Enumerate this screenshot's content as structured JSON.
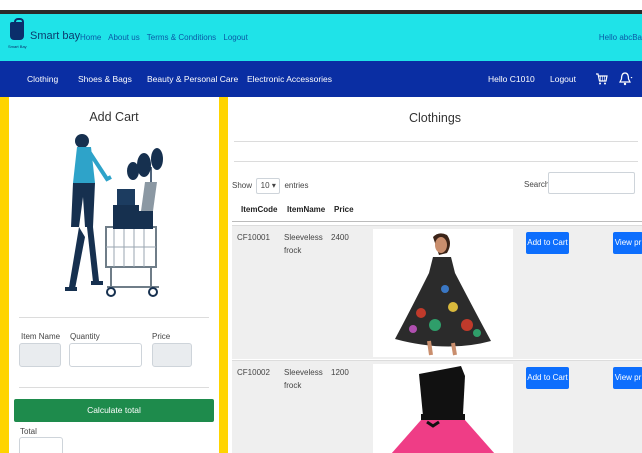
{
  "topbar": {
    "logo_caption": "Smart Bay",
    "brand": "Smart bay",
    "links": [
      "Home",
      "About us",
      "Terms & Conditions",
      "Logout"
    ],
    "hello": "Hello abcBa"
  },
  "navbar": {
    "items": [
      "Clothing",
      "Shoes & Bags",
      "Beauty & Personal Care",
      "Electronic Accessories"
    ],
    "hello_user": "Hello C1010",
    "logout": "Logout",
    "cart_icon": "shopping-cart-icon",
    "bell_icon": "bell-icon"
  },
  "add_cart": {
    "title": "Add Cart",
    "item_name_label": "Item Name",
    "quantity_label": "Quantity",
    "price_label": "Price",
    "item_name_value": "",
    "quantity_value": "",
    "price_value": "",
    "calculate_label": "Calculate total",
    "total_label": "Total",
    "total_value": ""
  },
  "catalog": {
    "title": "Clothings",
    "show_label": "Show",
    "entries_value": "10",
    "entries_label": "entries",
    "search_label": "Search:",
    "search_value": "",
    "columns": [
      "ItemCode",
      "ItemName",
      "Price"
    ],
    "rows": [
      {
        "code": "CF10001",
        "name_line1": "Sleeveless",
        "name_line2": "frock",
        "price": "2400",
        "add_label": "Add to Cart",
        "view_label": "View pr"
      },
      {
        "code": "CF10002",
        "name_line1": "Sleeveless",
        "name_line2": "frock",
        "price": "1200",
        "add_label": "Add to Cart",
        "view_label": "View pr"
      }
    ]
  },
  "colors": {
    "topbar": "#1fe3e8",
    "navbar": "#0a2ea3",
    "sidebar_border": "#ffd400",
    "calculate_button": "#1e8b4c",
    "primary_button": "#0d6efd"
  }
}
